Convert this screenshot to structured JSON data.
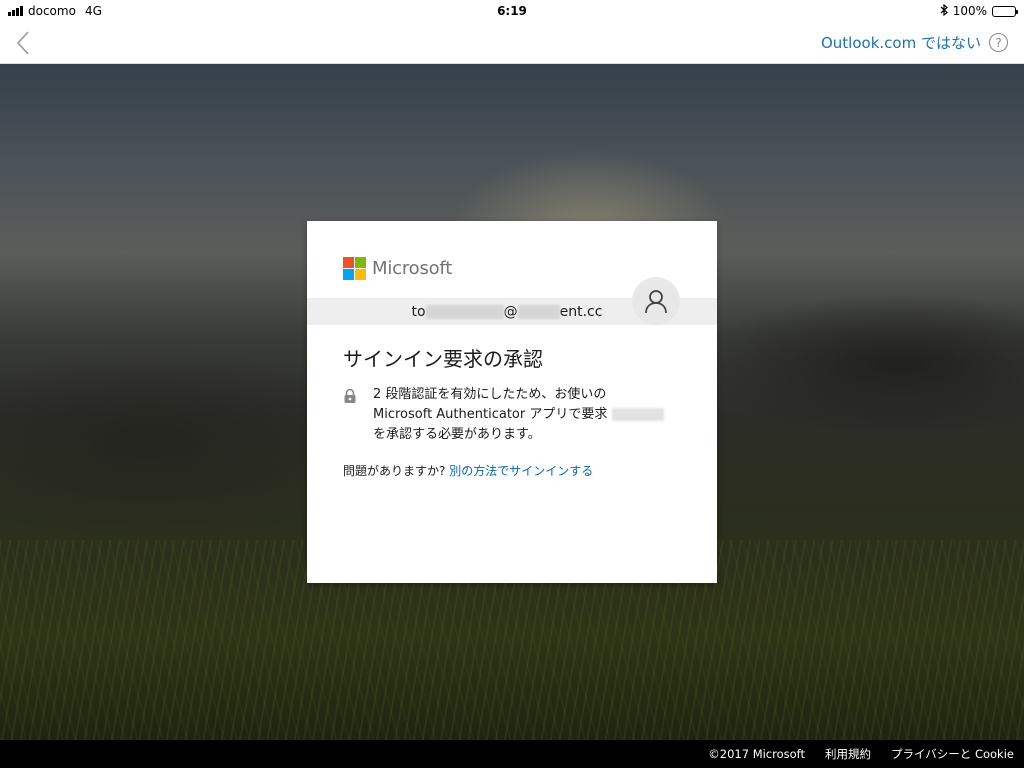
{
  "statusbar": {
    "carrier": "docomo",
    "network": "4G",
    "time": "6:19",
    "battery_percent": "100%",
    "battery_level": 1.0
  },
  "navbar": {
    "not_account_link": "Outlook.com",
    "not_account_suffix": "ではない",
    "help_label": "?"
  },
  "card": {
    "brand": "Microsoft",
    "identity": {
      "prefix": "to",
      "at": "@",
      "suffix": "ent.cc"
    },
    "title": "サインイン要求の承認",
    "message_line1": "2 段階認証を有効にしたため、お使いの",
    "message_line2": "Microsoft Authenticator アプリで要求",
    "message_line3": "を承認する必要があります。",
    "trouble_text": "問題がありますか?",
    "alt_signin_link": "別の方法でサインインする"
  },
  "footer": {
    "copyright": "©2017 Microsoft",
    "terms": "利用規約",
    "privacy": "プライバシーと Cookie"
  },
  "colors": {
    "ms_red": "#f25022",
    "ms_green": "#7fba00",
    "ms_blue": "#00a4ef",
    "ms_yellow": "#ffb900",
    "link_blue": "#0067b8",
    "nav_link_blue": "#1a72b5"
  }
}
